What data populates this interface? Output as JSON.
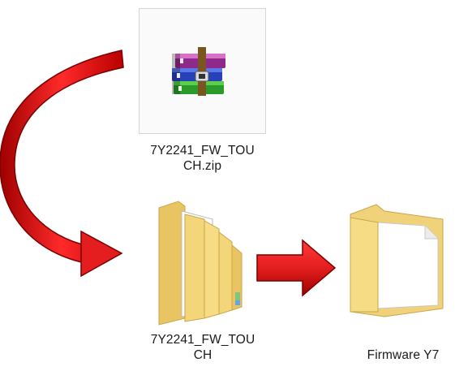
{
  "items": [
    {
      "name": "7Y2241_FW_TOU\nCH.zip",
      "line1": "7Y2241_FW_TOU",
      "line2": "CH.zip",
      "type": "zip-archive",
      "selected": true
    },
    {
      "name": "7Y2241_FW_TOU\nCH",
      "line1": "7Y2241_FW_TOU",
      "line2": "CH",
      "type": "folder-open-with-files"
    },
    {
      "name": "Firmware Y7",
      "line1": "Firmware Y7",
      "type": "folder-with-document"
    }
  ],
  "arrows": [
    {
      "name": "curved-arrow",
      "color": "#e41e1e",
      "from": "zip",
      "to": "extracted-folder"
    },
    {
      "name": "right-arrow",
      "color": "#e41e1e",
      "from": "extracted-folder",
      "to": "firmware-folder"
    }
  ],
  "colors": {
    "arrow_red": "#e41e1e",
    "arrow_dark": "#b40000",
    "folder": "#f3d67a",
    "selection_bg": "#fafafa"
  }
}
